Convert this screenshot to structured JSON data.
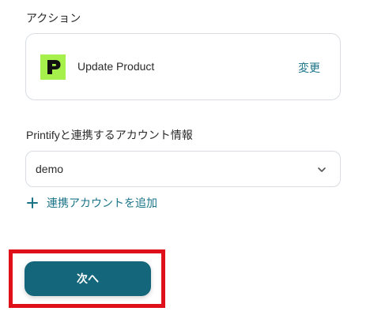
{
  "action_section": {
    "label": "アクション",
    "card": {
      "app_icon": "printify-logo-icon",
      "action_name": "Update Product",
      "change_label": "変更"
    }
  },
  "account_section": {
    "label": "Printifyと連携するアカウント情報",
    "selected_account": "demo",
    "add_account_label": "連携アカウントを追加"
  },
  "footer": {
    "next_label": "次へ"
  },
  "colors": {
    "accent": "#1a7388",
    "button": "#14667b",
    "highlight": "#e0101a",
    "logo_bg": "#a6f04b"
  }
}
